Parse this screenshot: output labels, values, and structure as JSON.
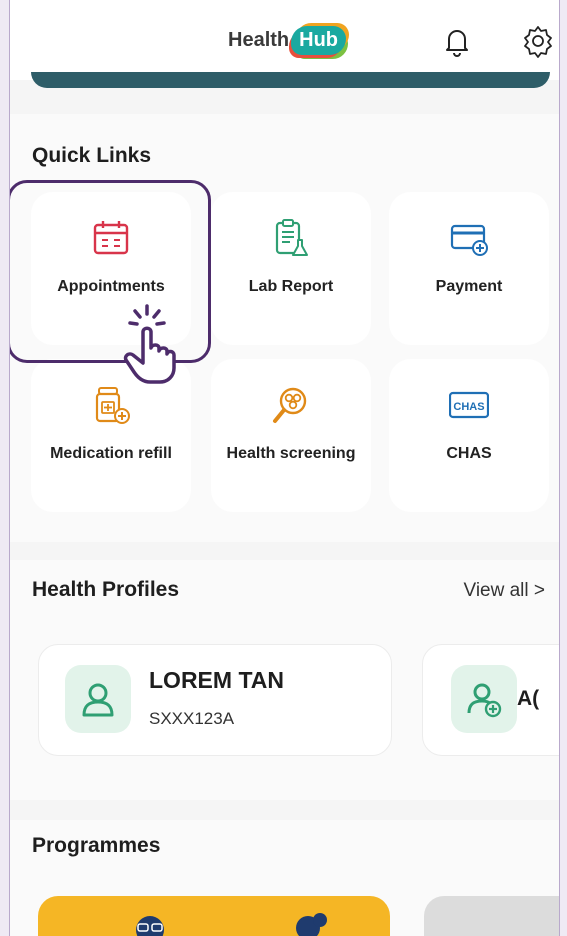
{
  "app": {
    "brand_prefix": "Health",
    "brand_suffix": "Hub"
  },
  "quick_links": {
    "title": "Quick Links",
    "items": [
      {
        "label": "Appointments",
        "icon": "calendar-icon"
      },
      {
        "label": "Lab Report",
        "icon": "clipboard-flask-icon"
      },
      {
        "label": "Payment",
        "icon": "card-plus-icon"
      },
      {
        "label": "Medication refill",
        "icon": "pill-bottle-plus-icon"
      },
      {
        "label": "Health screening",
        "icon": "magnifier-cells-icon"
      },
      {
        "label": "CHAS",
        "icon": "chas-card-icon"
      }
    ]
  },
  "chas_badge": "CHAS",
  "profiles": {
    "title": "Health Profiles",
    "view_all": "View all  >",
    "cards": [
      {
        "name": "LOREM TAN",
        "id": "SXXX123A"
      }
    ],
    "add_label": "A("
  },
  "programmes": {
    "title": "Programmes"
  },
  "colors": {
    "brand_teal": "#1aa9a0",
    "highlight_purple": "#4d2c6b",
    "icon_red": "#d8344a",
    "icon_green": "#2f9f73",
    "icon_blue": "#1f6fb5",
    "icon_orange": "#e08a18",
    "avatar_bg": "#e2f3ea"
  }
}
